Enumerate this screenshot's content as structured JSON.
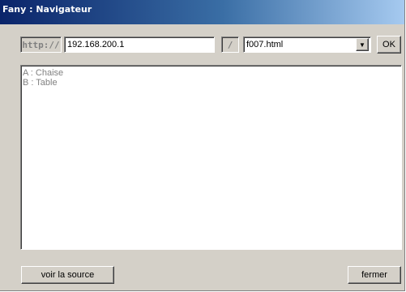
{
  "window": {
    "title": "Fany : Navigateur"
  },
  "address_bar": {
    "protocol_label": "http://",
    "host": "192.168.200.1",
    "separator_label": "/",
    "page": "f007.html",
    "ok_label": "OK"
  },
  "content": {
    "lines": [
      "A : Chaise",
      "B : Table"
    ]
  },
  "footer": {
    "view_source_label": "voir la source",
    "close_label": "fermer"
  },
  "icons": {
    "dropdown": "chevron-down-icon"
  },
  "colors": {
    "titlebar_start": "#0a246a",
    "titlebar_end": "#a6caf0",
    "face": "#d4d0c8"
  }
}
